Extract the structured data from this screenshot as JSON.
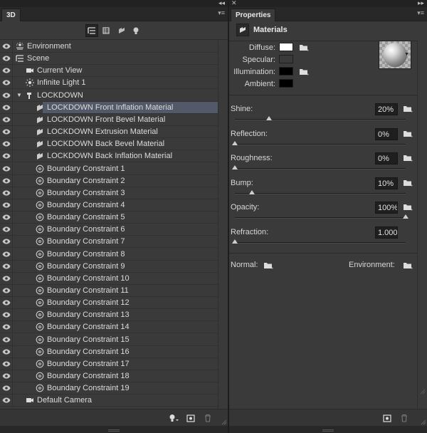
{
  "panel3d": {
    "tab_label": "3D",
    "tree": [
      {
        "label": "Environment",
        "icon": "environment-icon",
        "indent": 1,
        "eye": true
      },
      {
        "label": "Scene",
        "icon": "scene-icon",
        "indent": 1,
        "eye": true
      },
      {
        "label": "Current View",
        "icon": "camera-icon",
        "indent": 2,
        "eye": true
      },
      {
        "label": "Infinite Light 1",
        "icon": "light-icon",
        "indent": 2,
        "eye": true
      },
      {
        "label": "LOCKDOWN",
        "icon": "mesh-icon",
        "indent": 2,
        "eye": true,
        "expanded": true
      },
      {
        "label": "LOCKDOWN Front Inflation Material",
        "icon": "material-icon",
        "indent": 3,
        "eye": true,
        "selected": true
      },
      {
        "label": "LOCKDOWN Front Bevel Material",
        "icon": "material-icon",
        "indent": 3,
        "eye": true
      },
      {
        "label": "LOCKDOWN Extrusion Material",
        "icon": "material-icon",
        "indent": 3,
        "eye": true
      },
      {
        "label": "LOCKDOWN Back Bevel Material",
        "icon": "material-icon",
        "indent": 3,
        "eye": true
      },
      {
        "label": "LOCKDOWN Back Inflation Material",
        "icon": "material-icon",
        "indent": 3,
        "eye": true
      },
      {
        "label": "Boundary Constraint 1",
        "icon": "constraint-icon",
        "indent": 3,
        "eye": true
      },
      {
        "label": "Boundary Constraint 2",
        "icon": "constraint-icon",
        "indent": 3,
        "eye": true
      },
      {
        "label": "Boundary Constraint 3",
        "icon": "constraint-icon",
        "indent": 3,
        "eye": true
      },
      {
        "label": "Boundary Constraint 4",
        "icon": "constraint-icon",
        "indent": 3,
        "eye": true
      },
      {
        "label": "Boundary Constraint 5",
        "icon": "constraint-icon",
        "indent": 3,
        "eye": true
      },
      {
        "label": "Boundary Constraint 6",
        "icon": "constraint-icon",
        "indent": 3,
        "eye": true
      },
      {
        "label": "Boundary Constraint 7",
        "icon": "constraint-icon",
        "indent": 3,
        "eye": true
      },
      {
        "label": "Boundary Constraint 8",
        "icon": "constraint-icon",
        "indent": 3,
        "eye": true
      },
      {
        "label": "Boundary Constraint 9",
        "icon": "constraint-icon",
        "indent": 3,
        "eye": true
      },
      {
        "label": "Boundary Constraint 10",
        "icon": "constraint-icon",
        "indent": 3,
        "eye": true
      },
      {
        "label": "Boundary Constraint 11",
        "icon": "constraint-icon",
        "indent": 3,
        "eye": true
      },
      {
        "label": "Boundary Constraint 12",
        "icon": "constraint-icon",
        "indent": 3,
        "eye": true
      },
      {
        "label": "Boundary Constraint 13",
        "icon": "constraint-icon",
        "indent": 3,
        "eye": true
      },
      {
        "label": "Boundary Constraint 14",
        "icon": "constraint-icon",
        "indent": 3,
        "eye": true
      },
      {
        "label": "Boundary Constraint 15",
        "icon": "constraint-icon",
        "indent": 3,
        "eye": true
      },
      {
        "label": "Boundary Constraint 16",
        "icon": "constraint-icon",
        "indent": 3,
        "eye": true
      },
      {
        "label": "Boundary Constraint 17",
        "icon": "constraint-icon",
        "indent": 3,
        "eye": true
      },
      {
        "label": "Boundary Constraint 18",
        "icon": "constraint-icon",
        "indent": 3,
        "eye": true
      },
      {
        "label": "Boundary Constraint 19",
        "icon": "constraint-icon",
        "indent": 3,
        "eye": true
      },
      {
        "label": "Default Camera",
        "icon": "camera-icon",
        "indent": 2,
        "eye": true
      }
    ]
  },
  "properties": {
    "tab_label": "Properties",
    "section_title": "Materials",
    "colors": {
      "diffuse_label": "Diffuse:",
      "diffuse_color": "#ffffff",
      "specular_label": "Specular:",
      "specular_color": "#3a3a3a",
      "illumination_label": "Illumination:",
      "illumination_color": "#000000",
      "ambient_label": "Ambient:",
      "ambient_color": "#000000"
    },
    "sliders": [
      {
        "label": "Shine:",
        "value": "20%",
        "fraction": 0.2,
        "folder": true
      },
      {
        "label": "Reflection:",
        "value": "0%",
        "fraction": 0.0,
        "folder": true
      },
      {
        "label": "Roughness:",
        "value": "0%",
        "fraction": 0.0,
        "folder": true
      },
      {
        "label": "Bump:",
        "value": "10%",
        "fraction": 0.1,
        "folder": true
      },
      {
        "label": "Opacity:",
        "value": "100%",
        "fraction": 1.0,
        "folder": true
      },
      {
        "label": "Refraction:",
        "value": "1.000",
        "fraction": 0.0,
        "folder": false
      }
    ],
    "normal_label": "Normal:",
    "environment_label": "Environment:"
  },
  "theme": {
    "panel_bg": "#3a3a3a",
    "selection": "#525a6a",
    "field_bg": "#1f1f1f"
  }
}
